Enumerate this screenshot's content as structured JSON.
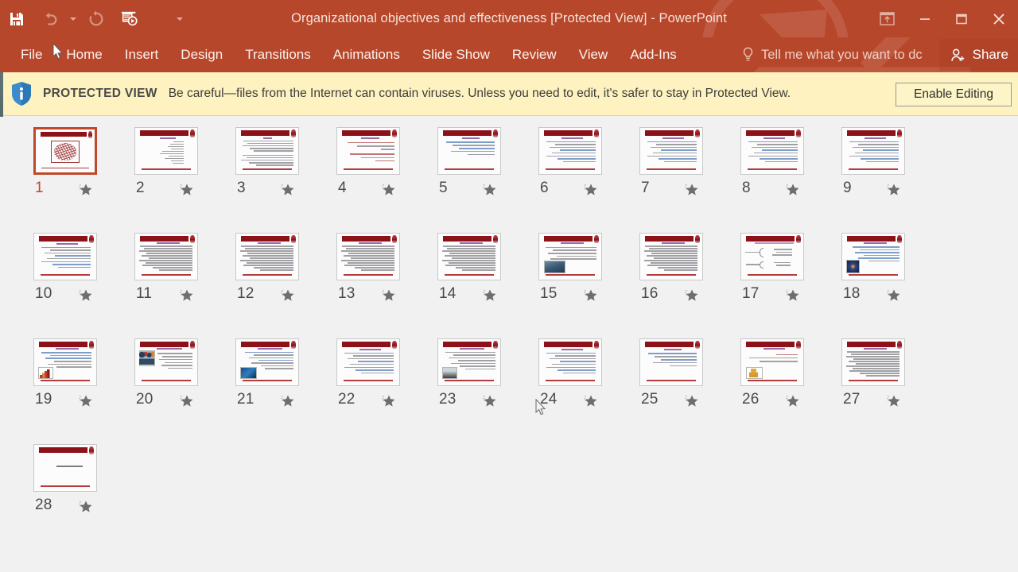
{
  "window": {
    "title": "Organizational objectives and effectiveness [Protected View] - PowerPoint",
    "accent_color": "#b7472a"
  },
  "quick_access": [
    {
      "name": "save-button",
      "icon": "save-icon",
      "enabled": true
    },
    {
      "name": "undo-button",
      "icon": "undo-icon",
      "enabled": false
    },
    {
      "name": "redo-button",
      "icon": "redo-icon",
      "enabled": false
    },
    {
      "name": "start-slideshow-button",
      "icon": "slideshow-icon",
      "enabled": true
    },
    {
      "name": "customize-qat-button",
      "icon": "chevron-down-icon",
      "enabled": true
    }
  ],
  "window_controls": {
    "ribbon_display_options": "ribbon-display-options-icon",
    "minimize": "minimize-icon",
    "restore": "restore-icon",
    "close": "close-icon"
  },
  "ribbon": {
    "tabs": [
      {
        "label": "File"
      },
      {
        "label": "Home"
      },
      {
        "label": "Insert"
      },
      {
        "label": "Design"
      },
      {
        "label": "Transitions"
      },
      {
        "label": "Animations"
      },
      {
        "label": "Slide Show"
      },
      {
        "label": "Review"
      },
      {
        "label": "View"
      },
      {
        "label": "Add-Ins"
      }
    ],
    "tell_me": "Tell me what you want to dc",
    "share_label": "Share"
  },
  "protected_view": {
    "label": "PROTECTED VIEW",
    "message": "Be careful—files from the Internet can contain viruses. Unless you need to edit, it's safer to stay in Protected View.",
    "enable_editing": "Enable Editing",
    "background_color": "#fdf2c0"
  },
  "slides": [
    {
      "number": "1",
      "selected": true,
      "kind": "calligraphy",
      "star": "star-icon"
    },
    {
      "number": "2",
      "selected": false,
      "kind": "list-right",
      "star": "star-icon"
    },
    {
      "number": "3",
      "selected": false,
      "kind": "text-two-block",
      "star": "star-icon"
    },
    {
      "number": "4",
      "selected": false,
      "kind": "text-red-accent",
      "star": "star-icon"
    },
    {
      "number": "5",
      "selected": false,
      "kind": "text-short",
      "star": "star-icon"
    },
    {
      "number": "6",
      "selected": false,
      "kind": "text-bullets",
      "star": "star-icon"
    },
    {
      "number": "7",
      "selected": false,
      "kind": "text-bullets",
      "star": "star-icon"
    },
    {
      "number": "8",
      "selected": false,
      "kind": "text-bullets",
      "star": "star-icon"
    },
    {
      "number": "9",
      "selected": false,
      "kind": "text-bullets",
      "star": "star-icon"
    },
    {
      "number": "10",
      "selected": false,
      "kind": "text-bullets",
      "star": "star-icon"
    },
    {
      "number": "11",
      "selected": false,
      "kind": "text-dense",
      "star": "star-icon"
    },
    {
      "number": "12",
      "selected": false,
      "kind": "text-dense",
      "star": "star-icon"
    },
    {
      "number": "13",
      "selected": false,
      "kind": "text-dense",
      "star": "star-icon"
    },
    {
      "number": "14",
      "selected": false,
      "kind": "text-dense",
      "star": "star-icon"
    },
    {
      "number": "15",
      "selected": false,
      "kind": "picture-bl",
      "star": "star-icon"
    },
    {
      "number": "16",
      "selected": false,
      "kind": "text-dense",
      "star": "star-icon"
    },
    {
      "number": "17",
      "selected": false,
      "kind": "diagram-brace",
      "star": "star-icon"
    },
    {
      "number": "18",
      "selected": false,
      "kind": "picture-bl-dark",
      "star": "star-icon"
    },
    {
      "number": "19",
      "selected": false,
      "kind": "chart-bl",
      "star": "star-icon"
    },
    {
      "number": "20",
      "selected": false,
      "kind": "picture-tl-people",
      "star": "star-icon"
    },
    {
      "number": "21",
      "selected": false,
      "kind": "picture-bl-blue",
      "star": "star-icon"
    },
    {
      "number": "22",
      "selected": false,
      "kind": "text-bullets",
      "star": "star-icon"
    },
    {
      "number": "23",
      "selected": false,
      "kind": "picture-bl-group",
      "star": "star-icon"
    },
    {
      "number": "24",
      "selected": false,
      "kind": "text-bullets",
      "star": "star-icon"
    },
    {
      "number": "25",
      "selected": false,
      "kind": "text-short",
      "star": "star-icon"
    },
    {
      "number": "26",
      "selected": false,
      "kind": "picture-bl-figure",
      "star": "star-icon"
    },
    {
      "number": "27",
      "selected": false,
      "kind": "text-dense",
      "star": "star-icon"
    },
    {
      "number": "28",
      "selected": false,
      "kind": "closing",
      "star": "star-icon"
    }
  ]
}
